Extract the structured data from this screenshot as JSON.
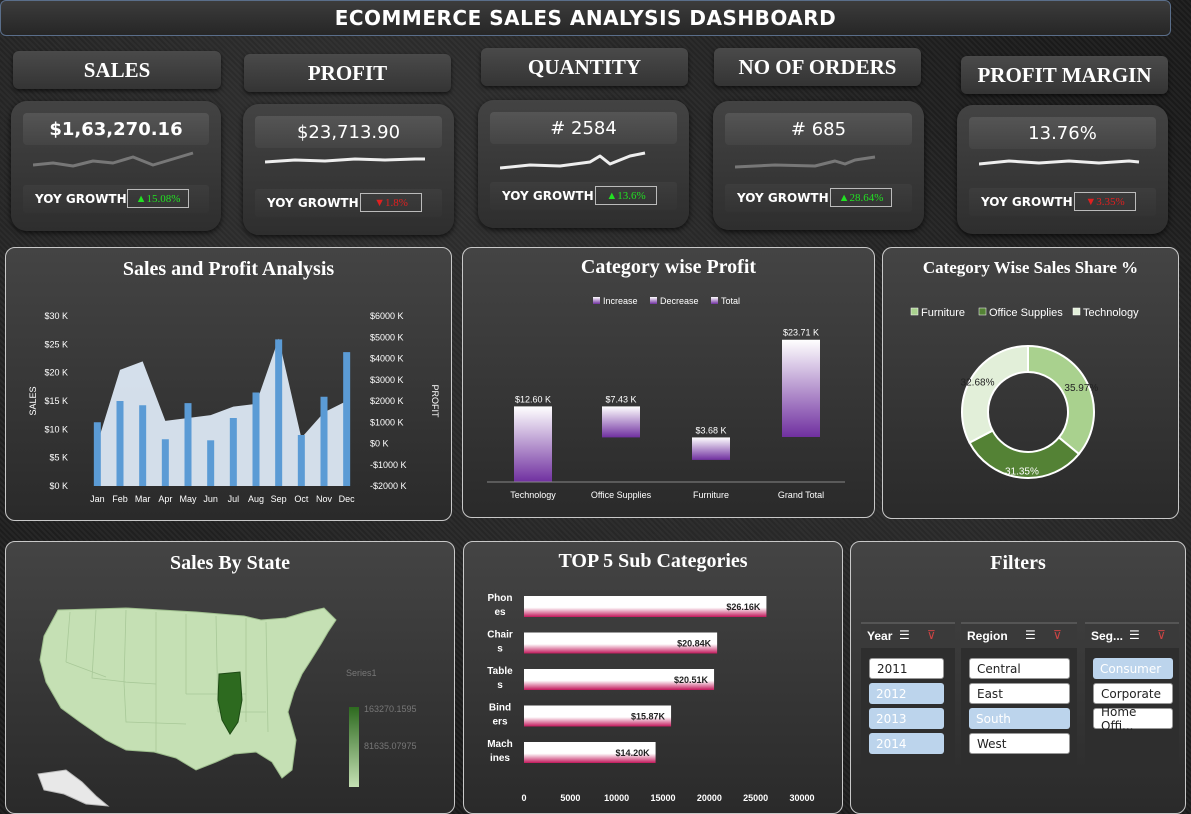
{
  "title": "ECOMMERCE SALES ANALYSIS DASHBOARD",
  "kpis": [
    {
      "label": "SALES",
      "value": "$1,63,270.16",
      "yoy_label": "YOY GROWTH",
      "yoy": "▲15.08%",
      "yoy_dir": "up"
    },
    {
      "label": "PROFIT",
      "value": "$23,713.90",
      "yoy_label": "YOY GROWTH",
      "yoy": "▼1.8%",
      "yoy_dir": "down"
    },
    {
      "label": "QUANTITY",
      "value": "# 2584",
      "yoy_label": "YOY GROWTH",
      "yoy": "▲13.6%",
      "yoy_dir": "up"
    },
    {
      "label": "NO OF ORDERS",
      "value": "# 685",
      "yoy_label": "YOY GROWTH",
      "yoy": "▲28.64%",
      "yoy_dir": "up"
    },
    {
      "label": "PROFIT MARGIN",
      "value": "13.76%",
      "yoy_label": "YOY GROWTH",
      "yoy": "▼3.35%",
      "yoy_dir": "down"
    }
  ],
  "colors": {
    "sales_area": "#dce8f4",
    "profit_bar": "#5b9bd5",
    "up": "#22e022",
    "down": "#e02020",
    "map_fill": "#c5e0b4",
    "map_highlight": "#2d6a1f",
    "donut_furniture": "#a9d18e",
    "donut_office": "#548235",
    "donut_tech": "#e2efd9",
    "bar_pink": "#c2185b",
    "waterfall_purple": "#7030a0"
  },
  "panels": {
    "sales_profit": "Sales and Profit Analysis",
    "category_profit": "Category wise Profit",
    "category_share": "Category Wise Sales Share %",
    "sales_state": "Sales By State",
    "top5": "TOP 5  Sub Categories",
    "filters": "Filters"
  },
  "chart_data": [
    {
      "type": "area",
      "title": "Sales and Profit Analysis",
      "categories": [
        "Jan",
        "Feb",
        "Mar",
        "Apr",
        "May",
        "Jun",
        "Jul",
        "Aug",
        "Sep",
        "Oct",
        "Nov",
        "Dec"
      ],
      "series": [
        {
          "name": "",
          "axis": "left",
          "kind": "area",
          "values": [
            7500,
            20500,
            22000,
            11500,
            12000,
            12500,
            14000,
            14500,
            26000,
            8500,
            13000,
            15000
          ]
        },
        {
          "name": "",
          "axis": "right",
          "kind": "bar",
          "values": [
            1000,
            2000,
            1800,
            200,
            1900,
            150,
            1200,
            2400,
            4900,
            400,
            2200,
            4300
          ]
        }
      ],
      "ylabel": "SALES",
      "y2label": "PROFIT",
      "ylim": [
        0,
        30000
      ],
      "y2lim": [
        -2000,
        6000
      ],
      "yticks": [
        "$0 K",
        "$5 K",
        "$10 K",
        "$15 K",
        "$20 K",
        "$25 K",
        "$30 K"
      ],
      "y2ticks": [
        "-$2000  K",
        "-$1000  K",
        "$0  K",
        "$1000  K",
        "$2000  K",
        "$3000  K",
        "$4000  K",
        "$5000  K",
        "$6000  K"
      ]
    },
    {
      "type": "bar",
      "subtype": "waterfall",
      "title": "Category wise Profit",
      "categories": [
        "Technology",
        "Office Supplies",
        "Furniture",
        "Grand Total"
      ],
      "values": [
        12600,
        7430,
        3680,
        23710
      ],
      "labels": [
        "$12.60 K",
        "$7.43 K",
        "$3.68 K",
        "$23.71 K"
      ],
      "legend": [
        "Increase",
        "Decrease",
        "Total"
      ]
    },
    {
      "type": "pie",
      "subtype": "donut",
      "title": "Category Wise Sales Share %",
      "categories": [
        "Furniture",
        "Office Supplies",
        "Technology"
      ],
      "values": [
        35.97,
        31.35,
        32.68
      ],
      "labels": [
        "35.97%",
        "31.35%",
        "32.68%"
      ]
    },
    {
      "type": "bar",
      "orientation": "horizontal",
      "title": "TOP 5  Sub Categories",
      "categories": [
        "Phones",
        "Chairs",
        "Tables",
        "Binders",
        "Machines"
      ],
      "category_lines": [
        [
          "Phon",
          "es"
        ],
        [
          "Chair",
          "s"
        ],
        [
          "Table",
          "s"
        ],
        [
          "Bind",
          "ers"
        ],
        [
          "Mach",
          "ines"
        ]
      ],
      "values": [
        26160,
        20840,
        20510,
        15870,
        14200
      ],
      "labels": [
        "$26.16K",
        "$20.84K",
        "$20.51K",
        "$15.87K",
        "$14.20K"
      ],
      "xlim": [
        0,
        30000
      ],
      "xticks": [
        "0",
        "5000",
        "10000",
        "15000",
        "20000",
        "25000",
        "30000"
      ]
    }
  ],
  "map": {
    "legend_series": "Series1",
    "legend_max": "163270.1595",
    "legend_mid": "81635.07975"
  },
  "filters": {
    "year": {
      "title": "Year",
      "items": [
        {
          "label": "2011",
          "on": true
        },
        {
          "label": "2012",
          "on": false
        },
        {
          "label": "2013",
          "on": false
        },
        {
          "label": "2014",
          "on": false
        }
      ]
    },
    "region": {
      "title": "Region",
      "items": [
        {
          "label": "Central",
          "on": true
        },
        {
          "label": "East",
          "on": true
        },
        {
          "label": "South",
          "on": false
        },
        {
          "label": "West",
          "on": true
        }
      ]
    },
    "segment": {
      "title": "Seg...",
      "items": [
        {
          "label": "Consumer",
          "on": false
        },
        {
          "label": "Corporate",
          "on": true
        },
        {
          "label": "Home Offi...",
          "on": true
        }
      ]
    }
  }
}
